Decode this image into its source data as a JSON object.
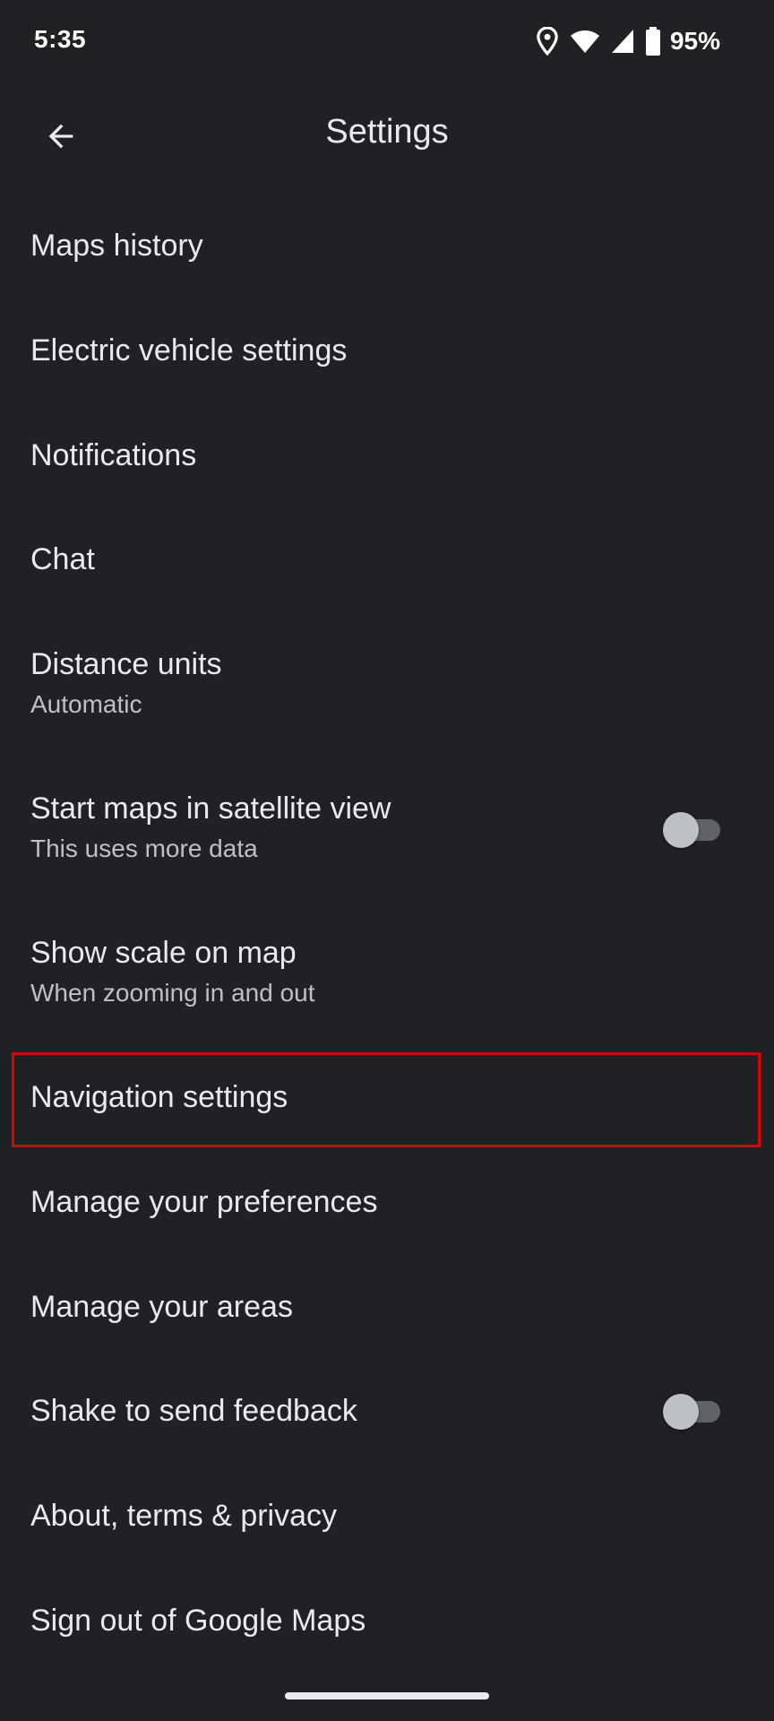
{
  "status_bar": {
    "time": "5:35",
    "battery_percent": "95%",
    "icons": [
      "location-icon",
      "wifi-icon",
      "signal-icon",
      "battery-icon"
    ]
  },
  "app_bar": {
    "title": "Settings",
    "back_icon": "arrow-back-icon"
  },
  "settings": {
    "items": [
      {
        "title": "Maps history"
      },
      {
        "title": "Electric vehicle settings"
      },
      {
        "title": "Notifications"
      },
      {
        "title": "Chat"
      },
      {
        "title": "Distance units",
        "subtitle": "Automatic"
      },
      {
        "title": "Start maps in satellite view",
        "subtitle": "This uses more data",
        "toggle": false
      },
      {
        "title": "Show scale on map",
        "subtitle": "When zooming in and out"
      },
      {
        "title": "Navigation settings",
        "highlighted": true
      },
      {
        "title": "Manage your preferences"
      },
      {
        "title": "Manage your areas"
      },
      {
        "title": "Shake to send feedback",
        "toggle": false
      },
      {
        "title": "About, terms & privacy"
      },
      {
        "title": "Sign out of Google Maps"
      }
    ]
  },
  "colors": {
    "background": "#202124",
    "text_primary": "#e8eaed",
    "text_secondary": "#bdc1c6",
    "highlight_border": "#e00000"
  }
}
